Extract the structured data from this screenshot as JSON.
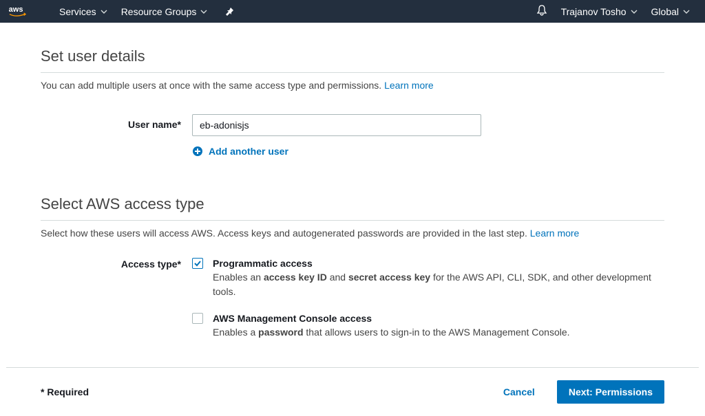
{
  "navbar": {
    "services_label": "Services",
    "resource_groups_label": "Resource Groups",
    "user_label": "Trajanov Tosho",
    "region_label": "Global"
  },
  "section1": {
    "title": "Set user details",
    "description_prefix": "You can add multiple users at once with the same access type and permissions. ",
    "learn_more": "Learn more",
    "username_label": "User name*",
    "username_value": "eb-adonisjs",
    "add_another_label": "Add another user"
  },
  "section2": {
    "title": "Select AWS access type",
    "description_prefix": "Select how these users will access AWS. Access keys and autogenerated passwords are provided in the last step. ",
    "learn_more": "Learn more",
    "access_type_label": "Access type*",
    "option1": {
      "title": "Programmatic access",
      "desc_before": "Enables an ",
      "desc_bold1": "access key ID",
      "desc_mid": " and ",
      "desc_bold2": "secret access key",
      "desc_after": " for the AWS API, CLI, SDK, and other development tools.",
      "checked": true
    },
    "option2": {
      "title": "AWS Management Console access",
      "desc_before": "Enables a ",
      "desc_bold1": "password",
      "desc_after": " that allows users to sign-in to the AWS Management Console.",
      "checked": false
    }
  },
  "footer": {
    "required_label": "* Required",
    "cancel_label": "Cancel",
    "next_label": "Next: Permissions"
  }
}
